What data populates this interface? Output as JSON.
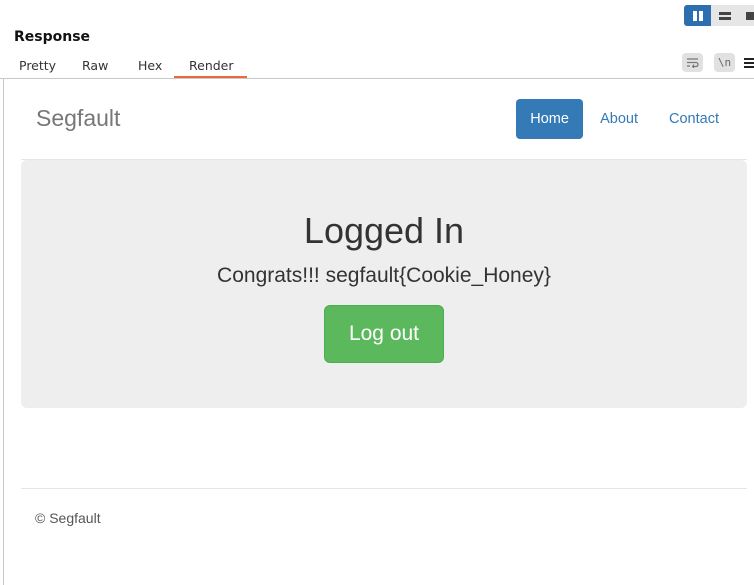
{
  "panel": {
    "title": "Response",
    "tabs": [
      "Pretty",
      "Raw",
      "Hex",
      "Render"
    ],
    "active_tab": "Render",
    "wrap_icon": "text-wrap-icon",
    "newline_label": "\\n",
    "menu_icon": "hamburger-menu-icon",
    "layout_toggles": [
      "split-columns-icon",
      "split-rows-icon",
      "single-pane-icon"
    ]
  },
  "site": {
    "brand": "Segfault",
    "nav": [
      "Home",
      "About",
      "Contact"
    ],
    "active_nav": "Home",
    "heading": "Logged In",
    "message": "Congrats!!! segfault{Cookie_Honey}",
    "button": "Log out",
    "footer": "© Segfault"
  },
  "colors": {
    "accent_tab": "#ea6a3c",
    "nav_active": "#337ab7",
    "button_success": "#5cb85c",
    "jumbotron_bg": "#eeeeee",
    "toggle_active": "#2c6eb0"
  }
}
